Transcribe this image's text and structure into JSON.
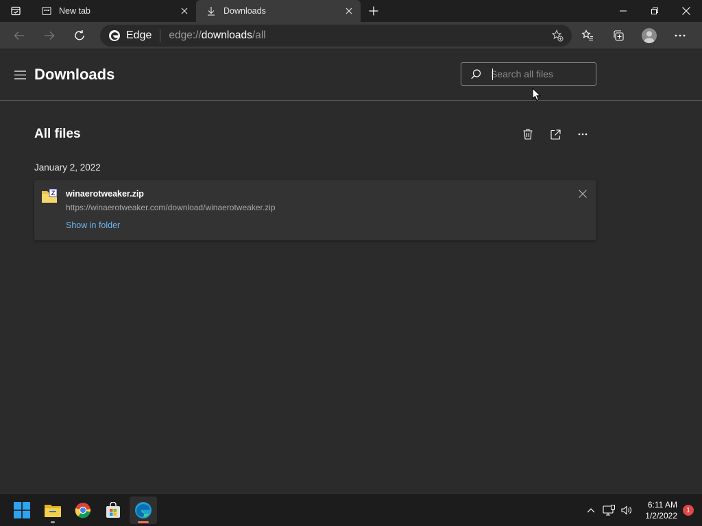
{
  "browser": {
    "tabs": [
      {
        "title": "New tab",
        "icon": "new-tab-page-icon",
        "active": false
      },
      {
        "title": "Downloads",
        "icon": "download-icon",
        "active": true
      }
    ],
    "address": {
      "site_label": "Edge",
      "url_prefix": "edge://",
      "url_host": "downloads",
      "url_path": "/all"
    }
  },
  "page": {
    "title": "Downloads",
    "search_placeholder": "Search all files",
    "section_title": "All files",
    "groups": [
      {
        "date": "January 2, 2022",
        "items": [
          {
            "file_name": "winaerotweaker.zip",
            "url": "https://winaerotweaker.com/download/winaerotweaker.zip",
            "action_label": "Show in folder"
          }
        ]
      }
    ]
  },
  "taskbar": {
    "apps": [
      "start-icon",
      "file-explorer-icon",
      "chrome-icon",
      "microsoft-store-icon",
      "edge-icon"
    ],
    "time": "6:11 AM",
    "date": "1/2/2022",
    "notification_count": "1"
  },
  "colors": {
    "page_bg": "#2b2b2b",
    "toolbar_bg": "#3b3b3b",
    "tabstrip_bg": "#1f1f1f",
    "link": "#6cb6ef",
    "taskbar_bg": "#1c1c1c"
  }
}
